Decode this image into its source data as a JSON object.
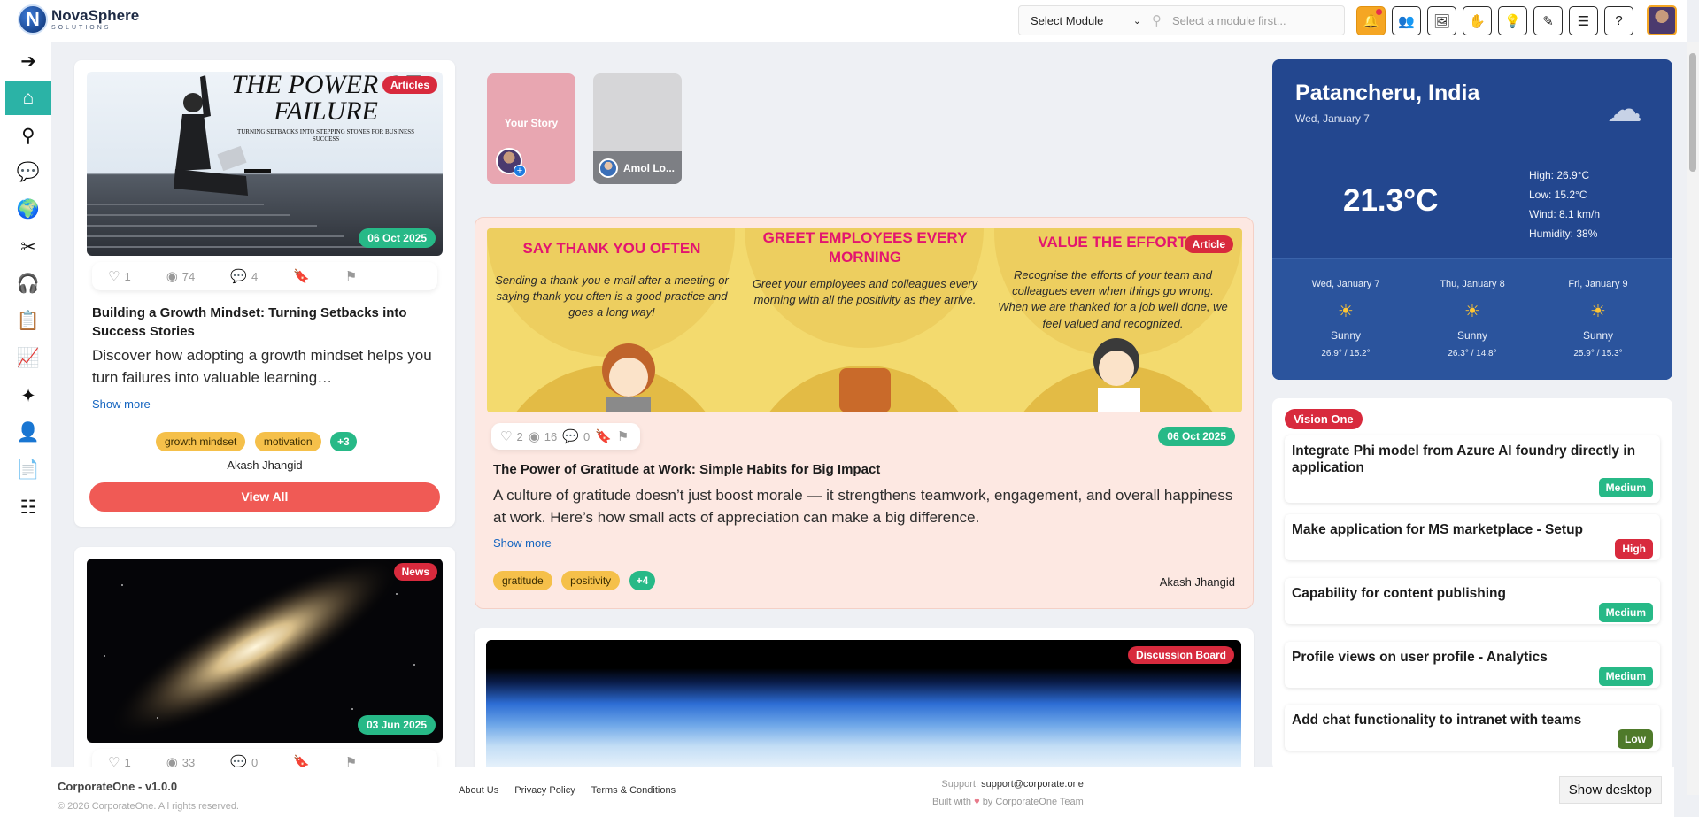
{
  "app": {
    "brand": "NovaSphere",
    "brand_sub": "SOLUTIONS",
    "brand_letter": "N"
  },
  "header": {
    "module_select": "Select Module",
    "module_search_placeholder": "Select a module first...",
    "buttons": [
      "bell-icon",
      "users-icon",
      "image-add-icon",
      "hand-icon",
      "lightbulb-icon",
      "pen-icon",
      "sliders-icon",
      "help-icon"
    ]
  },
  "sidebar": {
    "items": [
      "arrow-right-icon",
      "home-icon",
      "search-icon",
      "chat-icon",
      "globe-icon",
      "tools-icon",
      "support-icon",
      "clipboard-icon",
      "chart-icon",
      "sparkle-icon",
      "user-icon",
      "document-icon",
      "checklist-icon"
    ],
    "active_index": 1
  },
  "left_posts": [
    {
      "badge": "Articles",
      "image_title_1": "THE POWER OF",
      "image_title_2": "FAILURE",
      "image_subtitle": "TURNING SETBACKS INTO STEPPING STONES FOR BUSINESS SUCCESS",
      "date": "06 Oct 2025",
      "likes": "1",
      "views": "74",
      "comments": "4",
      "title": "Building a Growth Mindset: Turning Setbacks into Success Stories",
      "desc": "Discover how adopting a growth mindset helps you turn failures into valuable learning…",
      "show_more": "Show more",
      "tags": [
        "growth mindset",
        "motivation"
      ],
      "tags_more": "+3",
      "author": "Akash Jhangid",
      "view_all": "View All"
    },
    {
      "badge": "News",
      "date": "03 Jun 2025",
      "likes": "1",
      "views": "33",
      "comments": "0"
    }
  ],
  "stories": [
    {
      "label": "Your Story"
    },
    {
      "label": "Amol Lo..."
    }
  ],
  "featured": {
    "badge": "Article",
    "panels": [
      {
        "heading": "SAY THANK YOU OFTEN",
        "text": "Sending a thank-you e-mail after a meeting or saying thank you often is a good practice and goes a long way!"
      },
      {
        "heading": "GREET EMPLOYEES EVERY MORNING",
        "text": "Greet your employees and colleagues every morning with all the positivity as they arrive."
      },
      {
        "heading": "VALUE THE EFFORTS",
        "text": "Recognise the efforts of your team and colleagues even when things go wrong. When we are thanked for a job well done, we feel valued and recognized."
      }
    ],
    "likes": "2",
    "views": "16",
    "comments": "0",
    "date": "06 Oct 2025",
    "title": "The Power of Gratitude at Work: Simple Habits for Big Impact",
    "desc": "A culture of gratitude doesn’t just boost morale — it strengthens teamwork, engagement, and overall happiness at work. Here’s how small acts of appreciation can make a big difference.",
    "show_more": "Show more",
    "tags": [
      "gratitude",
      "positivity"
    ],
    "tags_more": "+4",
    "author": "Akash Jhangid"
  },
  "discussion": {
    "badge": "Discussion Board"
  },
  "weather": {
    "city": "Patancheru, India",
    "date": "Wed, January 7",
    "temp": "21.3°C",
    "high": "High: 26.9°C",
    "low": "Low: 15.2°C",
    "wind": "Wind: 8.1 km/h",
    "humidity": "Humidity: 38%",
    "forecast": [
      {
        "day": "Wed, January 7",
        "cond": "Sunny",
        "range": "26.9° / 15.2°"
      },
      {
        "day": "Thu, January 8",
        "cond": "Sunny",
        "range": "26.3° / 14.8°"
      },
      {
        "day": "Fri, January 9",
        "cond": "Sunny",
        "range": "25.9° / 15.3°"
      }
    ]
  },
  "vision": {
    "badge": "Vision One",
    "items": [
      {
        "title": "Integrate Phi model from Azure AI foundry directly in application",
        "priority": "Medium"
      },
      {
        "title": "Make application for MS marketplace - Setup",
        "priority": "High"
      },
      {
        "title": "Capability for content publishing",
        "priority": "Medium"
      },
      {
        "title": "Profile views on user profile - Analytics",
        "priority": "Medium"
      },
      {
        "title": "Add chat functionality to intranet with teams",
        "priority": "Low"
      }
    ]
  },
  "footer": {
    "brand": "CorporateOne - v1.0.0",
    "copyright": "© 2026 CorporateOne. All rights reserved.",
    "links": [
      "About Us",
      "Privacy Policy",
      "Terms & Conditions"
    ],
    "support_label": "Support:",
    "support_email": "support@corporate.one",
    "built_pre": "Built with",
    "built_post": "by CorporateOne Team",
    "show_desktop": "Show desktop"
  },
  "colors": {
    "accent": "#2bb3a6",
    "red": "#d82a3d",
    "green": "#27b987",
    "weather_bg": "#23478f",
    "tag": "#f5c04a"
  }
}
